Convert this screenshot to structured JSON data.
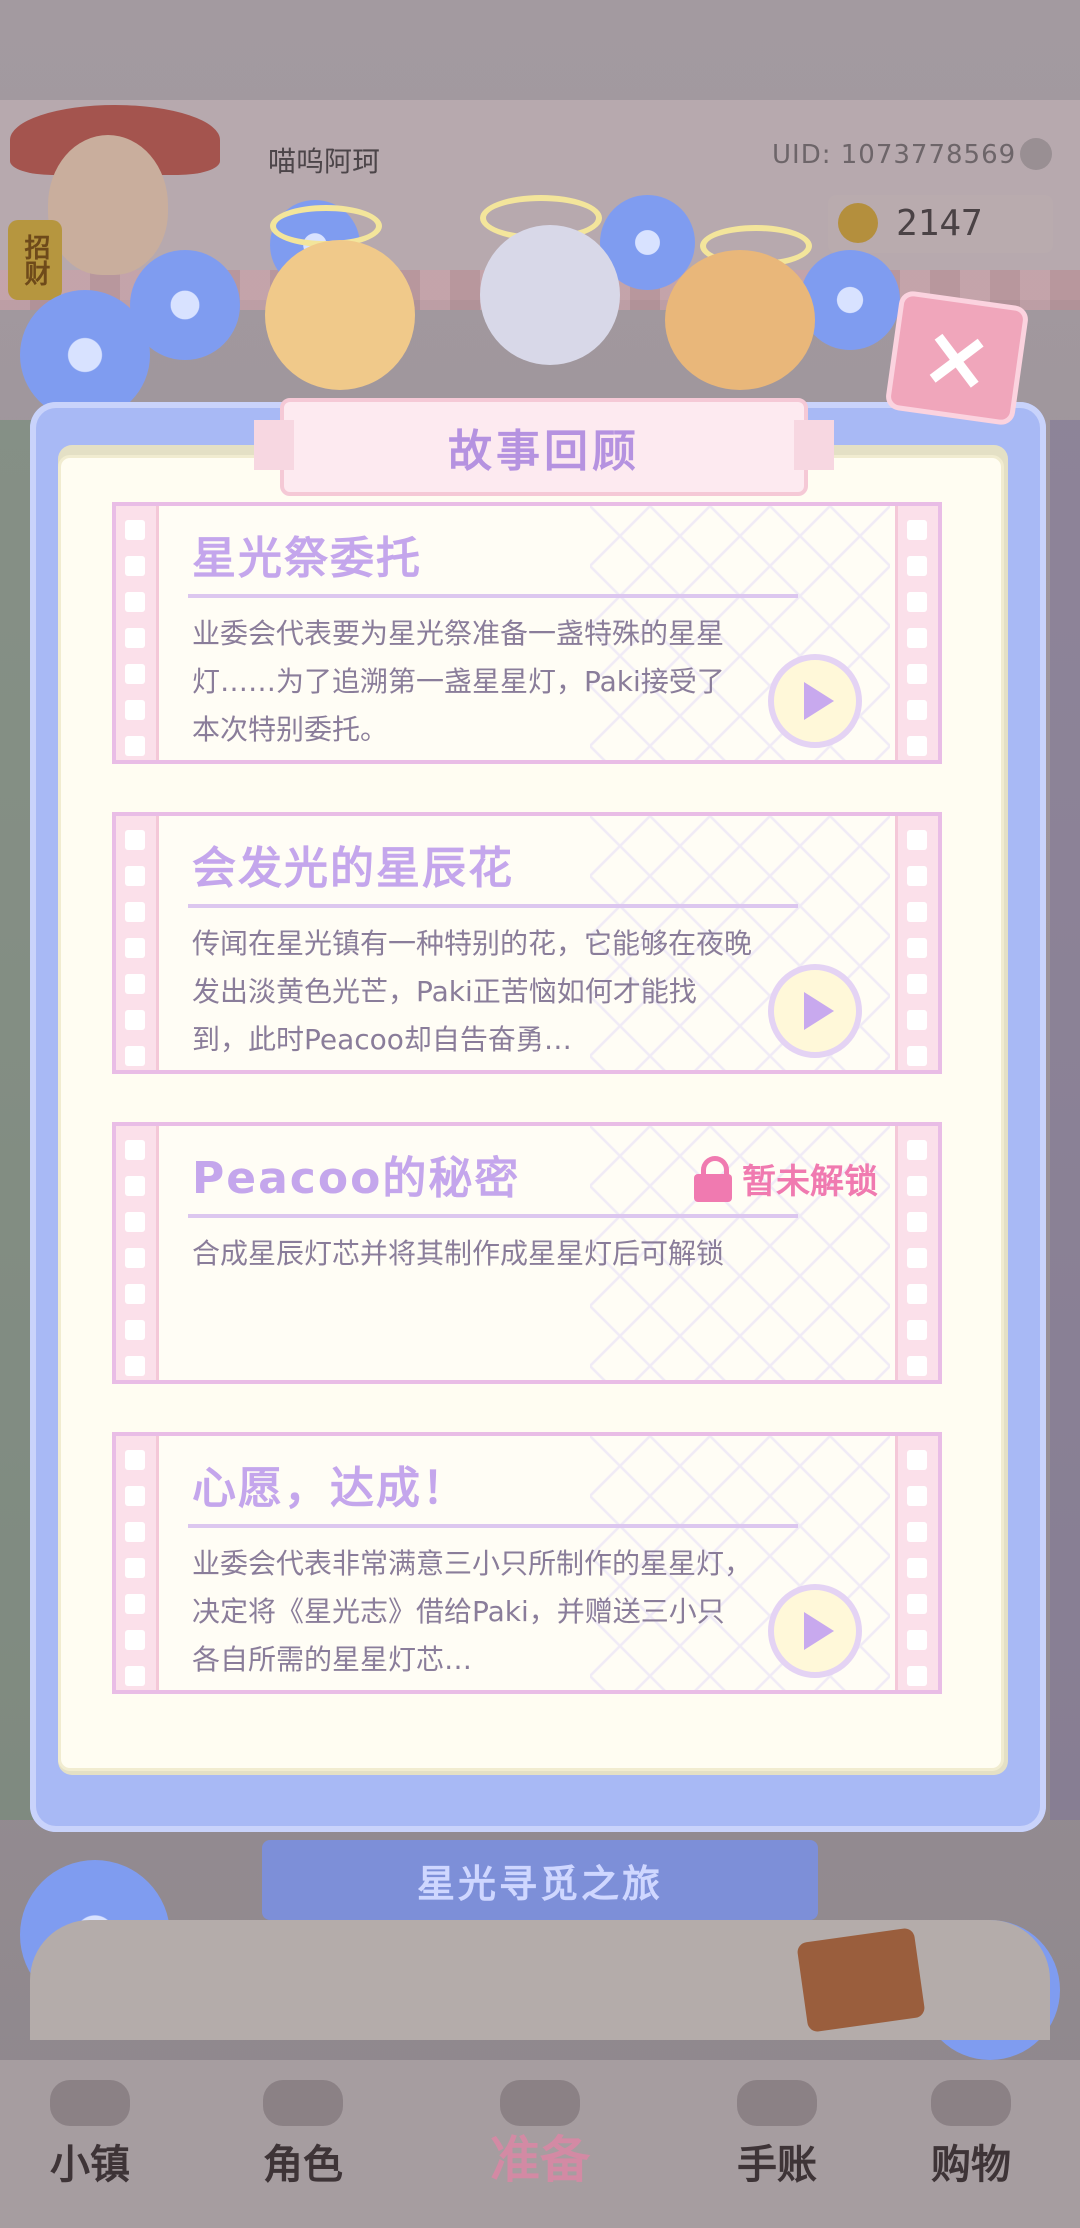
{
  "header": {
    "username": "喵呜阿珂",
    "uid": "UID: 1073778569",
    "coins": "2147",
    "avatar_badge": "招财"
  },
  "modal": {
    "title": "故事回顾",
    "close_label": "×",
    "stories": [
      {
        "title": "星光祭委托",
        "desc": "业委会代表要为星光祭准备一盏特殊的星星灯……为了追溯第一盏星星灯，Paki接受了本次特别委托。",
        "locked": false
      },
      {
        "title": "会发光的星辰花",
        "desc": "传闻在星光镇有一种特别的花，它能够在夜晚发出淡黄色光芒，Paki正苦恼如何才能找到，此时Peacoo却自告奋勇…",
        "locked": false
      },
      {
        "title": "Peacoo的秘密",
        "desc": "合成星辰灯芯并将其制作成星星灯后可解锁",
        "locked": true,
        "lock_label": "暂未解锁"
      },
      {
        "title": "心愿，达成！",
        "desc": "业委会代表非常满意三小只所制作的星星灯，决定将《星光志》借给Paki，并赠送三小只各自所需的星星灯芯…",
        "locked": false
      }
    ]
  },
  "banner": {
    "text": "星光寻觅之旅"
  },
  "nav": {
    "items": [
      {
        "label": "小镇",
        "icon": "town-icon"
      },
      {
        "label": "角色",
        "icon": "character-icon"
      },
      {
        "label": "准备",
        "icon": "prepare-icon",
        "active": true
      },
      {
        "label": "手账",
        "icon": "journal-icon"
      },
      {
        "label": "购物",
        "icon": "shop-icon"
      }
    ]
  },
  "colors": {
    "accent": "#c4a6ec",
    "locked": "#f07ab0",
    "modal_frame": "#a8b9f5",
    "close": "#f0a6bb"
  }
}
